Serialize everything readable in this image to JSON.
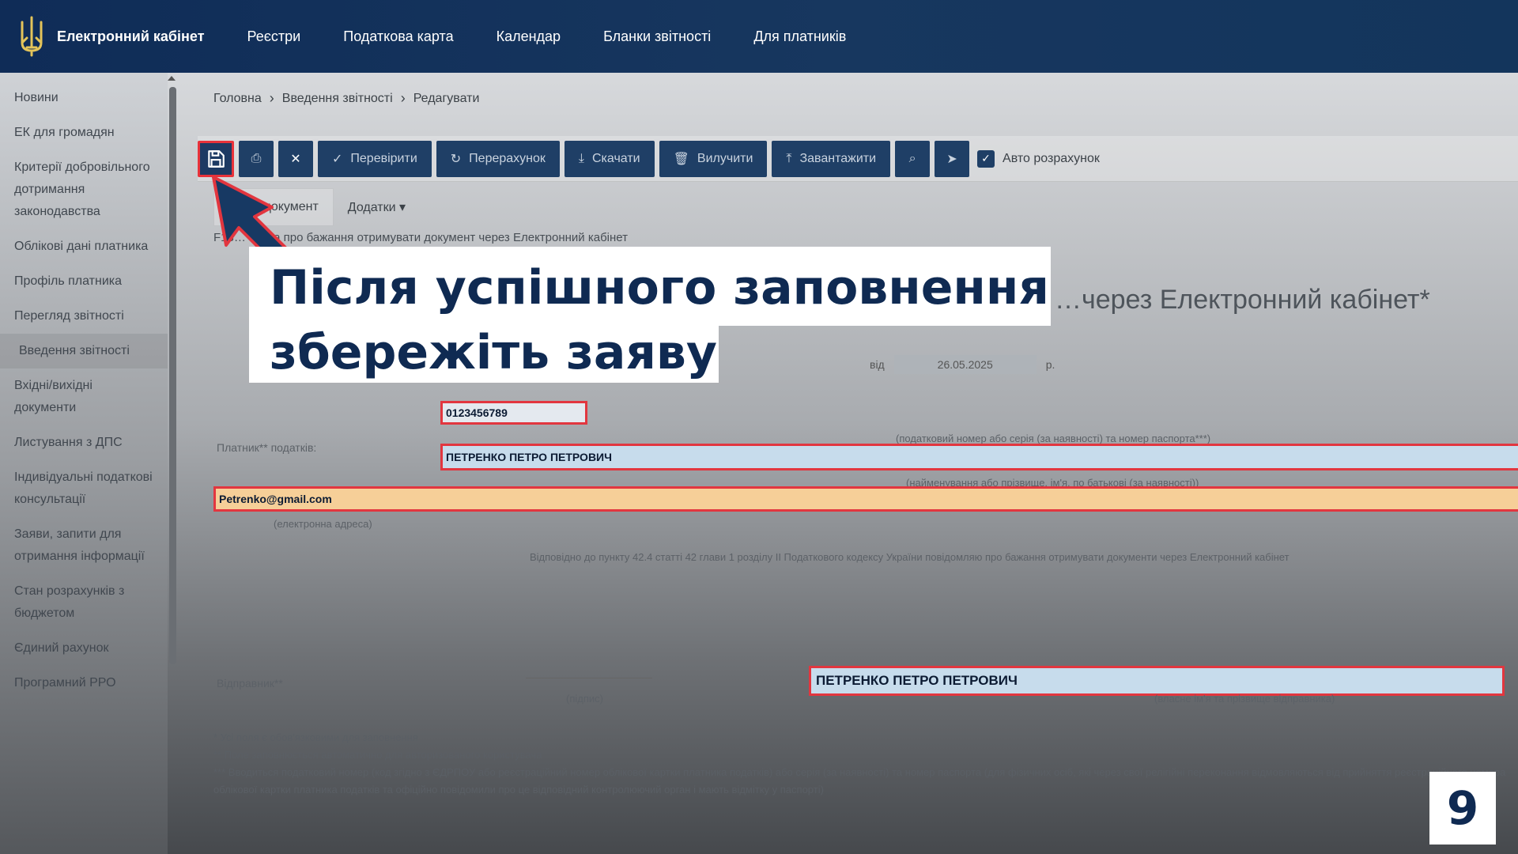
{
  "header": {
    "brand": "Електронний кабінет",
    "nav": [
      "Реєстри",
      "Податкова карта",
      "Календар",
      "Бланки звітності",
      "Для платників"
    ]
  },
  "sidebar": {
    "items": [
      "Новини",
      "ЕК для громадян",
      "Критерії добровільного дотримання законодавства",
      "Облікові дані платника",
      "Профіль платника",
      "Перегляд звітності",
      "Введення звітності",
      "Вхідні/вихідні документи",
      "Листування з ДПС",
      "Індивідуальні податкові консультації",
      "Заяви, запити для отримання інформації",
      "Стан розрахунків з бюджетом",
      "Єдиний рахунок",
      "Програмний РРО"
    ],
    "active_index": 6
  },
  "breadcrumb": [
    "Головна",
    "Введення звітності",
    "Редагувати"
  ],
  "toolbar": {
    "buttons": [
      "Перевірити",
      "Перерахунок",
      "Скачати",
      "Вилучити",
      "Завантажити"
    ],
    "auto_calc_label": "Авто розрахунок",
    "auto_calc_checked": true
  },
  "tabs": [
    "...ний документ",
    "Додатки ▾"
  ],
  "document_line": "F13… заява про бажання отримувати документ через Електронний кабінет",
  "form": {
    "title": "…через Електронний кабінет*",
    "date_prefix": "від",
    "date": "26.05.2025",
    "date_suffix": "р.",
    "tax_number": "0123456789",
    "tax_hint": "(податковий номер або серія (за наявності) та номер паспорта***)",
    "payer_label": "Платник** податків:",
    "payer_name": "ПЕТРЕНКО ПЕТРО ПЕТРОВИЧ",
    "name_hint": "(найменування або прізвище, ім'я, по батькові (за наявності))",
    "email": "Petrenko@gmail.com",
    "email_hint": "(електронна адреса)",
    "statement": "Відповідно до пункту 42.4 статті 42 глави 1 розділу II Податкового кодексу України повідомляю про бажання отримувати документи через Електронний кабінет",
    "sender_label": "Відправник**",
    "signature_hint": "(підпис)",
    "sender_name": "ПЕТРЕНКО ПЕТРО ПЕТРОВИЧ",
    "sender_hint": "(власне ім'я та прізвище відправника)",
    "notes": [
      "* Усі поля є обов'язковими для заповнення",
      "** Поле заповнюється автоматично для авторизованого користувача",
      "*** Вводиться податковий номер (код згідно з ЄДРПОУ або реєстраційний номер облікової картки платника податків) або серія (за наявності) та номер паспорта (для фізичних осіб, які через свої релігійні переконання відмовляються від прийняття реєстраційного номера облікової картки платника податків та офіційно повідомили про це відповідний контролюючий орган і мають відмітку у паспорті)"
    ]
  },
  "callout": {
    "line1": "Після успішного заповнення",
    "line2": "збережіть заяву"
  },
  "page_number": "9",
  "colors": {
    "header_bg": "#0f2c57",
    "toolbar_button": "#1f3f66",
    "highlight_border": "#e2363f",
    "callout_text": "#0f2a52",
    "name_field_bg": "#c7dcec",
    "email_field_bg": "#f6cf98"
  }
}
